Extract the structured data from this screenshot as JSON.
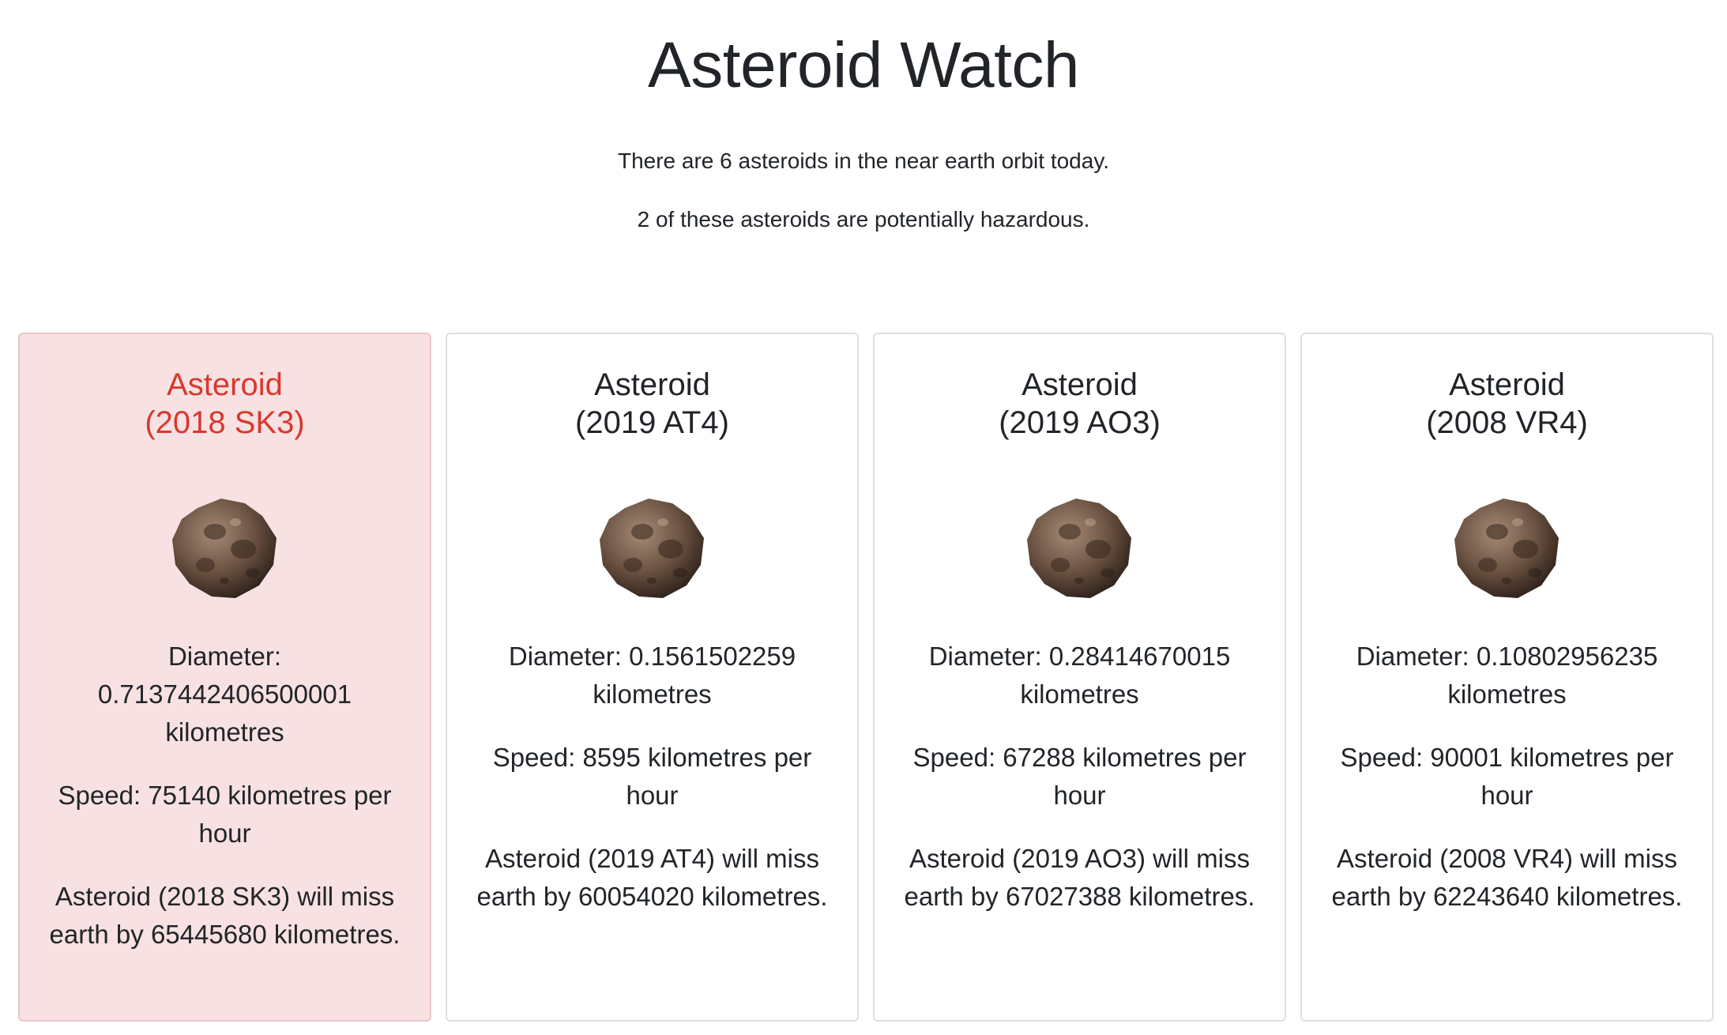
{
  "header": {
    "title": "Asteroid Watch",
    "count_text": "There are 6 asteroids in the near earth orbit today.",
    "hazard_text": "2 of these asteroids are potentially hazardous."
  },
  "colors": {
    "hazard_text": "#d9382e",
    "hazard_bg": "#f8e1e2",
    "text": "#212529"
  },
  "cards": [
    {
      "hazardous": true,
      "title_line1": "Asteroid",
      "title_line2": "(2018 SK3)",
      "diameter": "Diameter: 0.7137442406500001 kilometres",
      "speed": "Speed: 75140 kilometres per hour",
      "miss": "Asteroid (2018 SK3) will miss earth by 65445680 kilometres."
    },
    {
      "hazardous": false,
      "title_line1": "Asteroid",
      "title_line2": "(2019 AT4)",
      "diameter": "Diameter: 0.1561502259 kilometres",
      "speed": "Speed: 8595 kilometres per hour",
      "miss": "Asteroid (2019 AT4) will miss earth by 60054020 kilometres."
    },
    {
      "hazardous": false,
      "title_line1": "Asteroid",
      "title_line2": "(2019 AO3)",
      "diameter": "Diameter: 0.28414670015 kilometres",
      "speed": "Speed: 67288 kilometres per hour",
      "miss": "Asteroid (2019 AO3) will miss earth by 67027388 kilometres."
    },
    {
      "hazardous": false,
      "title_line1": "Asteroid",
      "title_line2": "(2008 VR4)",
      "diameter": "Diameter: 0.10802956235 kilometres",
      "speed": "Speed: 90001 kilometres per hour",
      "miss": "Asteroid (2008 VR4) will miss earth by 62243640 kilometres."
    }
  ]
}
